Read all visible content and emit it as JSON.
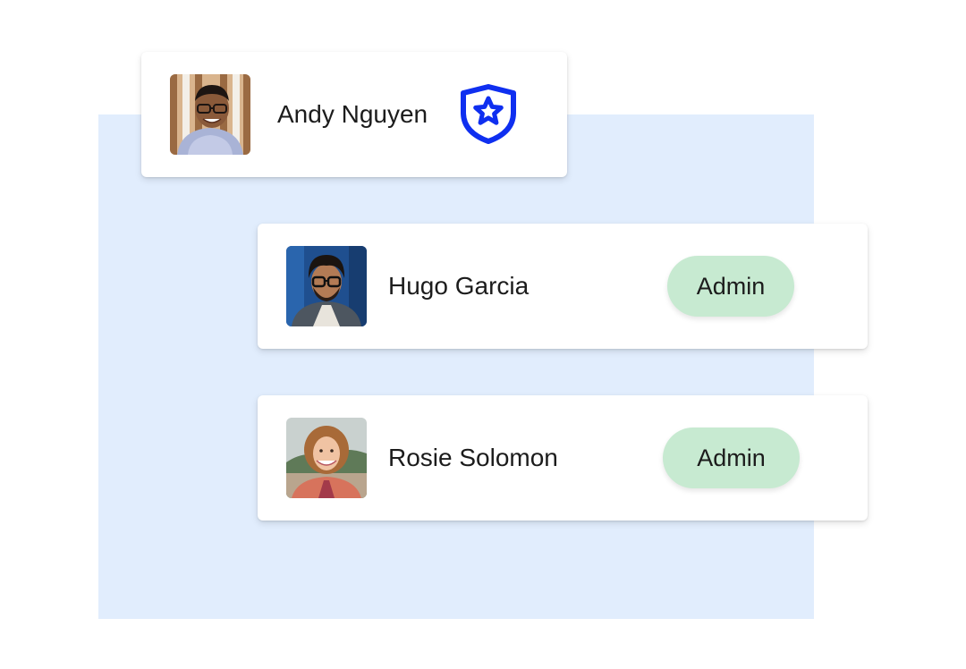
{
  "users": [
    {
      "name": "Andy Nguyen",
      "avatar_icon": "person-photo-icon",
      "role_icon": "shield-star-icon"
    },
    {
      "name": "Hugo Garcia",
      "avatar_icon": "person-photo-icon",
      "role": "Admin"
    },
    {
      "name": "Rosie Solomon",
      "avatar_icon": "person-photo-icon",
      "role": "Admin"
    }
  ],
  "colors": {
    "backdrop": "#e1edfd",
    "shield": "#0f2ff0",
    "admin_badge": "#c7ead1",
    "card": "#ffffff",
    "text": "#1c1c1c"
  }
}
